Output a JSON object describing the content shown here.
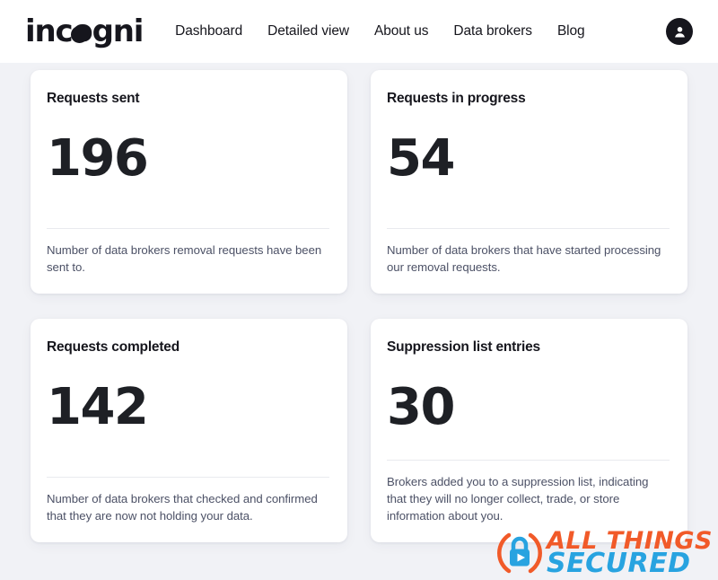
{
  "header": {
    "logo_text": "incogni",
    "logo_icon": "incogni-wordmark",
    "nav": [
      {
        "label": "Dashboard"
      },
      {
        "label": "Detailed view"
      },
      {
        "label": "About us"
      },
      {
        "label": "Data brokers"
      },
      {
        "label": "Blog"
      }
    ],
    "avatar_icon": "user-account-icon"
  },
  "cards": [
    {
      "title": "Requests sent",
      "value": "196",
      "description": "Number of data brokers removal requests have been sent to."
    },
    {
      "title": "Requests in progress",
      "value": "54",
      "description": "Number of data brokers that have started processing our removal requests."
    },
    {
      "title": "Requests completed",
      "value": "142",
      "description": "Number of data brokers that checked and confirmed that they are now not holding your data."
    },
    {
      "title": "Suppression list entries",
      "value": "30",
      "description": "Brokers added you to a suppression list, indicating that they will no longer collect, trade, or store information about you."
    }
  ],
  "watermark": {
    "icon": "padlock-play-icon",
    "line1": "ALL THINGS",
    "line2": "SECURED",
    "color_orange": "#f15a29",
    "color_blue": "#28a3e0"
  },
  "colors": {
    "page_background": "#f1f2f6",
    "card_background": "#ffffff",
    "text_primary": "#16161d",
    "value_color": "#1e2025",
    "description_color": "#4c5166",
    "rule_color": "#e9eaee"
  }
}
